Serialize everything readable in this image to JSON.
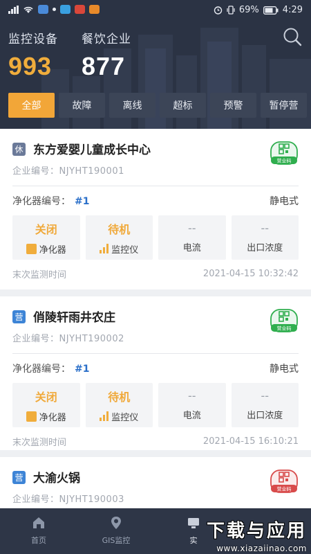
{
  "statusbar": {
    "battery": "69%",
    "time": "4:29"
  },
  "header": {
    "monitor_label": "监控设备",
    "monitor_value": "993",
    "enterprise_label": "餐饮企业",
    "enterprise_value": "877"
  },
  "tabs": [
    {
      "label": "全部",
      "active": true
    },
    {
      "label": "故障"
    },
    {
      "label": "离线"
    },
    {
      "label": "超标"
    },
    {
      "label": "预警"
    },
    {
      "label": "暂停营"
    }
  ],
  "cards": [
    {
      "badge": "休",
      "name": "东方爱婴儿童成长中心",
      "ent_label": "企业编号：",
      "ent_code": "NJYHT190001",
      "code_icon_caption": "营业码",
      "purifier_label": "净化器编号：",
      "purifier_no": "#1",
      "purifier_type": "静电式",
      "cells": [
        {
          "top": "关闭",
          "bottom": "净化器"
        },
        {
          "top": "待机",
          "bottom": "监控仪"
        },
        {
          "top": "--",
          "bottom": "电流"
        },
        {
          "top": "--",
          "bottom": "出口浓度"
        }
      ],
      "time_label": "末次监测时间",
      "time_value": "2021-04-15 10:32:42"
    },
    {
      "badge": "营",
      "name": "俏陵轩雨井农庄",
      "ent_label": "企业编号：",
      "ent_code": "NJYHT190002",
      "code_icon_caption": "营业码",
      "purifier_label": "净化器编号：",
      "purifier_no": "#1",
      "purifier_type": "静电式",
      "cells": [
        {
          "top": "关闭",
          "bottom": "净化器"
        },
        {
          "top": "待机",
          "bottom": "监控仪"
        },
        {
          "top": "--",
          "bottom": "电流"
        },
        {
          "top": "--",
          "bottom": "出口浓度"
        }
      ],
      "time_label": "末次监测时间",
      "time_value": "2021-04-15 16:10:21"
    },
    {
      "badge": "营",
      "name": "大渝火锅",
      "ent_label": "企业编号：",
      "ent_code": "NJYHT190003",
      "code_icon_caption": "营业码"
    }
  ],
  "nav": [
    {
      "label": "首页"
    },
    {
      "label": "GIS监控"
    },
    {
      "label": "实"
    }
  ],
  "watermark": {
    "title": "下载与应用",
    "url": "www.xiazaiinao.com"
  },
  "colors": {
    "accent": "#f2a638",
    "header_bg": "#2b3344",
    "link_blue": "#2a6fc9",
    "code_green": "#2fae4e",
    "code_red": "#d84b4b"
  },
  "icons": {
    "search": "search-icon",
    "code_green": "green-code-icon",
    "code_red": "red-code-icon",
    "purifier": "purifier-square-icon",
    "monitor": "signal-bars-icon",
    "home": "home-icon",
    "gis": "location-pin-icon"
  }
}
